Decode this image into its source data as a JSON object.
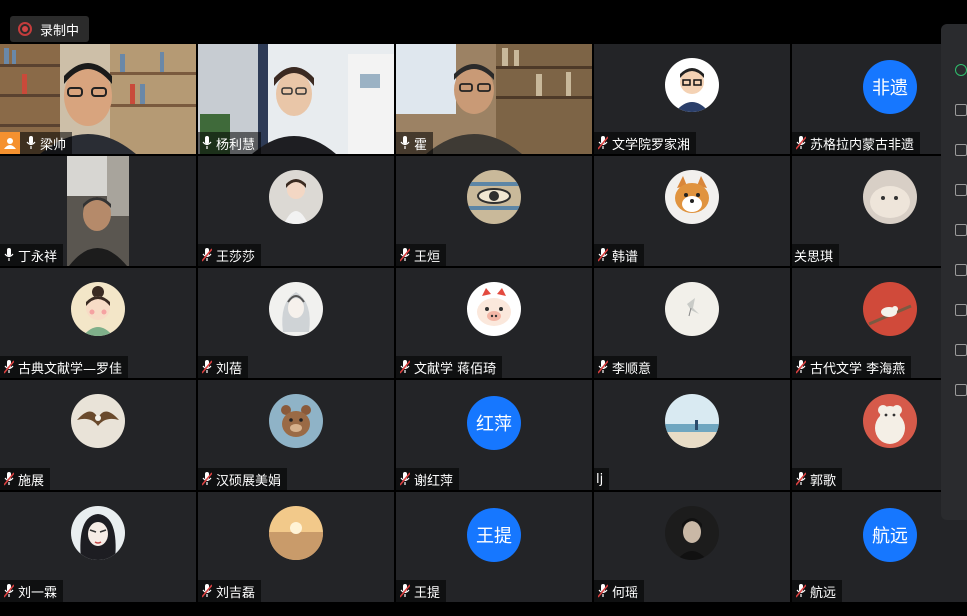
{
  "recording": {
    "label": "录制中"
  },
  "colors": {
    "accent_blue": "#1677ff",
    "active_border": "#2fbf6d",
    "host_badge": "#f5912f",
    "mic_muted": "#d94040"
  },
  "participants": [
    {
      "name": "梁帅",
      "type": "video",
      "mic": "on",
      "host": true
    },
    {
      "name": "杨利慧",
      "type": "video",
      "mic": "on",
      "active": true
    },
    {
      "name": "霍",
      "type": "video",
      "mic": "on"
    },
    {
      "name": "文学院罗家湘",
      "type": "avatar",
      "avatar_icon": "cartoon-man-glasses-avatar",
      "mic": "muted"
    },
    {
      "name": "苏格拉内蒙古非遗",
      "type": "text-avatar",
      "avatar_text": "非遗",
      "mic": "muted"
    },
    {
      "name": "丁永祥",
      "type": "video-small",
      "mic": "on"
    },
    {
      "name": "王莎莎",
      "type": "avatar",
      "avatar_icon": "child-photo-avatar",
      "mic": "muted"
    },
    {
      "name": "王烜",
      "type": "avatar",
      "avatar_icon": "eye-painting-avatar",
      "mic": "muted"
    },
    {
      "name": "韩谱",
      "type": "avatar",
      "avatar_icon": "shiba-dog-avatar",
      "mic": "muted"
    },
    {
      "name": "关思琪",
      "type": "avatar",
      "avatar_icon": "plush-toy-avatar",
      "mic": "none"
    },
    {
      "name": "古典文献学—罗佳",
      "type": "avatar",
      "avatar_icon": "cartoon-girl-avatar",
      "mic": "muted"
    },
    {
      "name": "刘蓓",
      "type": "avatar",
      "avatar_icon": "ink-portrait-avatar",
      "mic": "muted"
    },
    {
      "name": "文献学  蒋佰琦",
      "type": "avatar",
      "avatar_icon": "cartoon-pig-avatar",
      "mic": "muted"
    },
    {
      "name": "李顺意",
      "type": "avatar",
      "avatar_icon": "bird-sketch-avatar",
      "mic": "muted"
    },
    {
      "name": "古代文学 李海燕",
      "type": "avatar",
      "avatar_icon": "bird-on-branch-avatar",
      "mic": "muted"
    },
    {
      "name": "施展",
      "type": "avatar",
      "avatar_icon": "eagle-avatar",
      "mic": "muted"
    },
    {
      "name": "汉硕展美娟",
      "type": "avatar",
      "avatar_icon": "cartoon-bear-avatar",
      "mic": "muted"
    },
    {
      "name": "谢红萍",
      "type": "text-avatar",
      "avatar_text": "红萍",
      "mic": "muted"
    },
    {
      "name": "lj",
      "type": "avatar",
      "avatar_icon": "beach-scene-avatar",
      "mic": "none"
    },
    {
      "name": "郭歌",
      "type": "avatar",
      "avatar_icon": "bear-illustration-avatar",
      "mic": "muted"
    },
    {
      "name": "刘一霖",
      "type": "avatar",
      "avatar_icon": "anime-girl-avatar",
      "mic": "muted"
    },
    {
      "name": "刘吉磊",
      "type": "avatar",
      "avatar_icon": "sunset-sea-avatar",
      "mic": "muted"
    },
    {
      "name": "王提",
      "type": "text-avatar",
      "avatar_text": "王提",
      "mic": "muted"
    },
    {
      "name": "何瑶",
      "type": "avatar",
      "avatar_icon": "dark-portrait-avatar",
      "mic": "muted"
    },
    {
      "name": "航远",
      "type": "text-avatar",
      "avatar_text": "航远",
      "mic": "muted"
    }
  ],
  "side_panel": {
    "icons": [
      "chat-icon",
      "participants-icon",
      "apps-icon",
      "files-icon",
      "settings-icon",
      "more-icon",
      "emoji-icon",
      "document-icon",
      "menu-icon"
    ]
  }
}
